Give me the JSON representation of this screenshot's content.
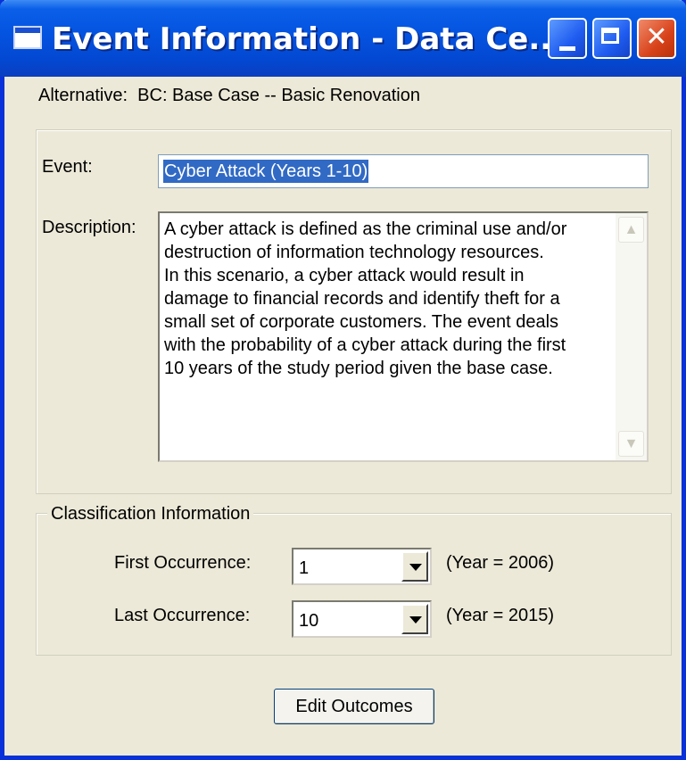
{
  "window": {
    "title": "Event Information - Data Ce...",
    "controls": {
      "minimize": "minimize",
      "maximize": "maximize",
      "close": "✕"
    }
  },
  "alternative_text": "Alternative:  BC: Base Case -- Basic Renovation",
  "event": {
    "label": "Event:",
    "value": "Cyber Attack (Years 1-10)"
  },
  "description": {
    "label": "Description:",
    "lines": [
      "A cyber attack is defined as the criminal use and/or",
      "destruction of information technology resources.",
      "In this scenario, a cyber attack would result in",
      "damage to financial records and identify theft for a",
      "small set of corporate customers. The event deals",
      "with the probability of a cyber attack during the first",
      "10 years of the study period given the base case."
    ]
  },
  "classification": {
    "legend": "Classification Information",
    "first_occurrence": {
      "label": "First Occurrence:",
      "value": "1",
      "year_note": "(Year = 2006)"
    },
    "last_occurrence": {
      "label": "Last Occurrence:",
      "value": "10",
      "year_note": "(Year = 2015)"
    }
  },
  "buttons": {
    "edit_outcomes": "Edit Outcomes"
  },
  "icons": [
    "window-icon",
    "minimize-icon",
    "maximize-icon",
    "close-icon",
    "scroll-up-icon",
    "scroll-down-icon",
    "dropdown-arrow-icon"
  ],
  "colors": {
    "titlebar": "#0453e0",
    "window_bg": "#ece9d8",
    "selection": "#316ac5",
    "close_button": "#d8431b"
  }
}
